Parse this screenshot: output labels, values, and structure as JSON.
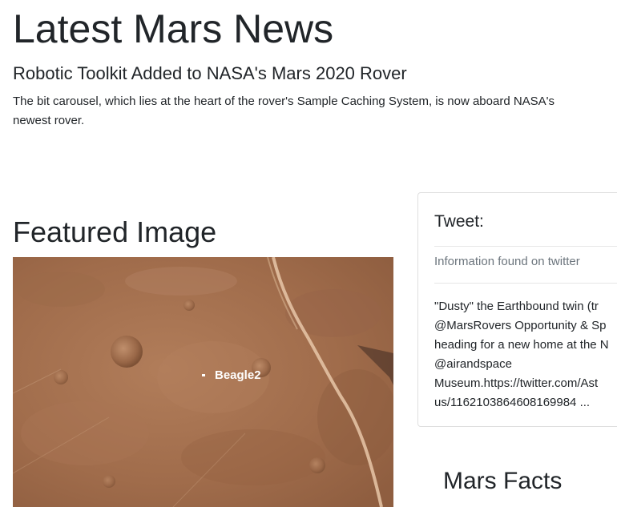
{
  "page": {
    "title": "Latest Mars News"
  },
  "news": {
    "title": "Robotic Toolkit Added to NASA's Mars 2020 Rover",
    "paragraph": "The bit carousel, which lies at the heart of the rover's Sample Caching System, is now aboard NASA's newest rover."
  },
  "featured": {
    "heading": "Featured Image",
    "image_label": "Beagle2"
  },
  "tweet": {
    "title": "Tweet:",
    "subtitle": "Information found on twitter",
    "lines": [
      "\"Dusty\" the Earthbound twin (tr",
      "@MarsRovers Opportunity & Sp",
      "heading for a new home at the N",
      "@airandspace",
      "Museum.https://twitter.com/Ast",
      "us/1162103864608169984 ..."
    ]
  },
  "facts": {
    "heading": "Mars Facts"
  },
  "colors": {
    "text": "#212529",
    "muted": "#6c757d",
    "border": "#dfdfdf",
    "mars_surface": "#a4714f"
  }
}
